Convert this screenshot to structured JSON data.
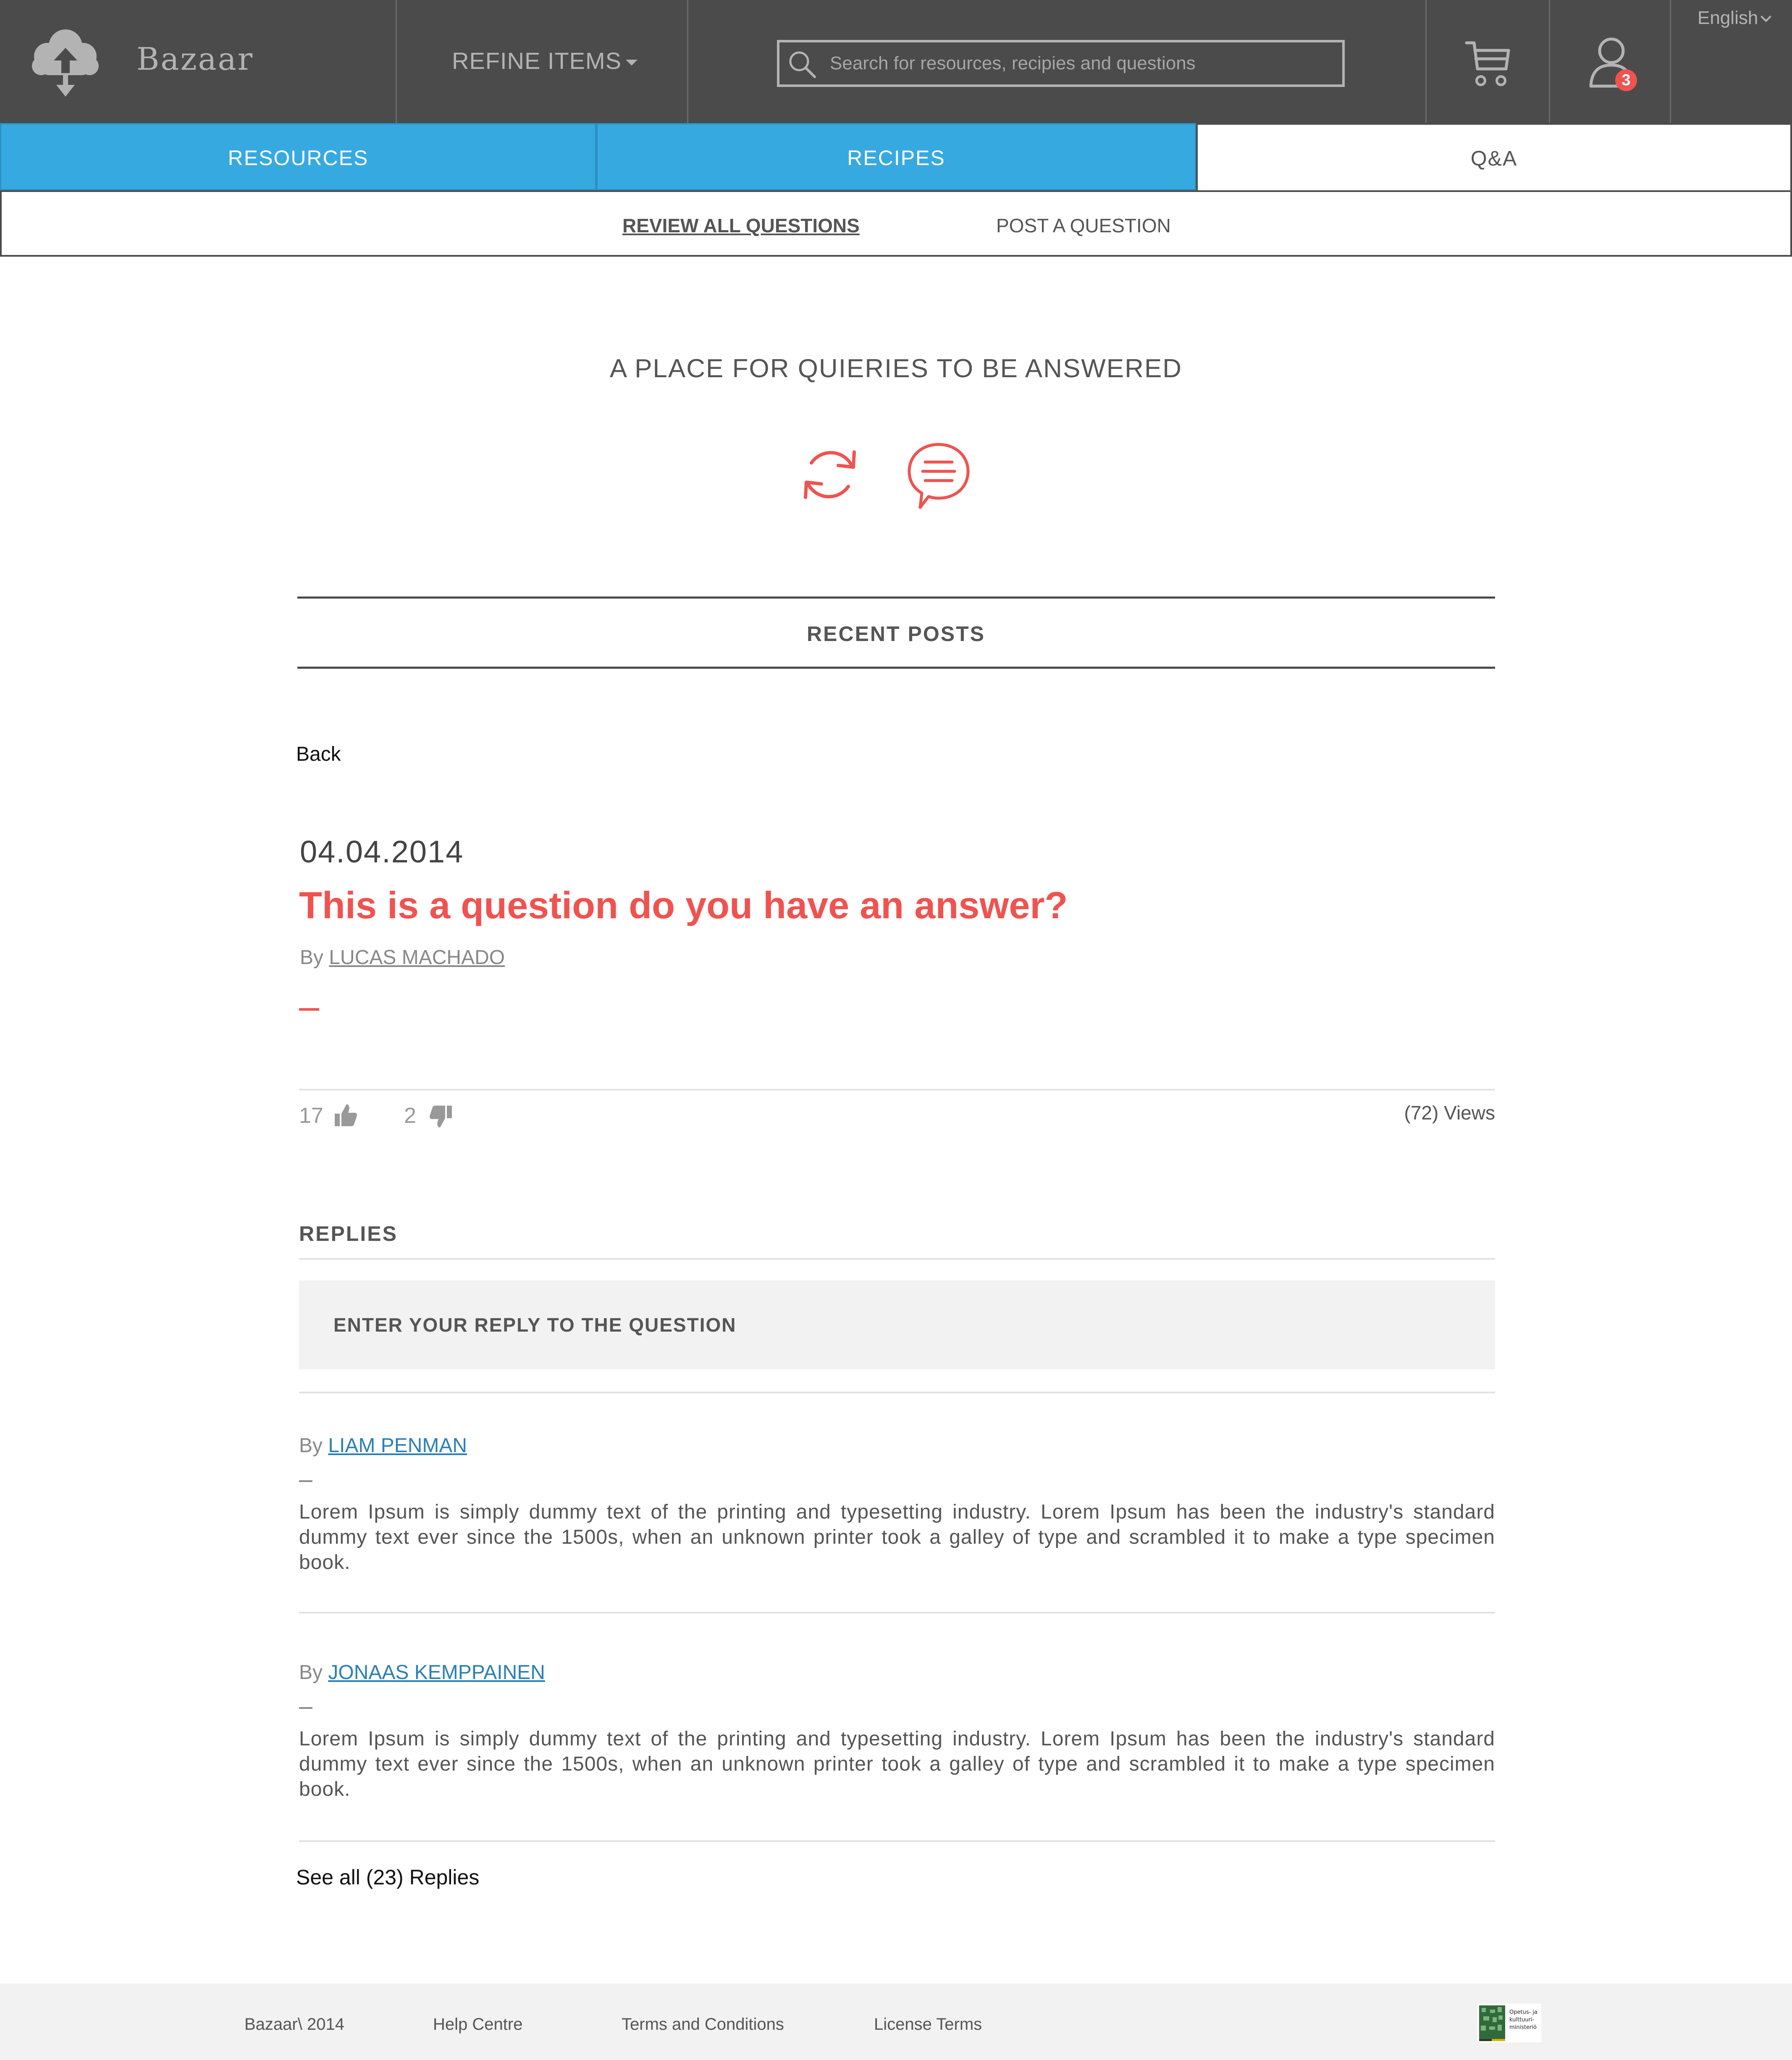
{
  "header": {
    "brand": "Bazaar",
    "refine_label": "REFINE ITEMS",
    "search_placeholder": "Search for resources, recipies and questions",
    "notification_count": "3",
    "language": "English"
  },
  "tabs": [
    {
      "label": "RESOURCES"
    },
    {
      "label": "RECIPES"
    },
    {
      "label": "Q&A"
    }
  ],
  "subnav": {
    "review_label": "REVIEW ALL QUESTIONS",
    "post_label": "POST A QUESTION"
  },
  "hero": {
    "title": "A PLACE FOR QUIERIES TO BE ANSWERED"
  },
  "recent_posts": {
    "title": "RECENT POSTS",
    "back_label": "Back"
  },
  "post": {
    "date": "04.04.2014",
    "title": "This is a question do you have an answer?",
    "by_label": "By",
    "author": "LUCAS MACHADO",
    "likes": "17",
    "dislikes": "2",
    "views": "(72) Views"
  },
  "replies": {
    "title": "REPLIES",
    "input_placeholder": "ENTER YOUR REPLY TO THE QUESTION",
    "items": [
      {
        "by_label": "By",
        "author": "LIAM PENMAN",
        "text": "Lorem Ipsum is simply dummy text of the printing and typesetting industry. Lorem Ipsum has been the industry's standard dummy text ever since the 1500s, when an unknown printer took a galley of type and scrambled it to make a type specimen book."
      },
      {
        "by_label": "By",
        "author": "JONAAS KEMPPAINEN",
        "text": "Lorem Ipsum is simply dummy text of the printing and typesetting industry. Lorem Ipsum has been the industry's standard dummy text ever since the 1500s, when an unknown printer took a galley of type and scrambled it to make a type specimen book."
      }
    ],
    "see_all_label": "See all (23) Replies"
  },
  "footer": {
    "copyright": "Bazaar\\ 2014",
    "help": "Help Centre",
    "terms": "Terms and Conditions",
    "license": "License Terms",
    "logo_text": [
      "Opetus- ja",
      "kulttuuri-",
      "ministeriö"
    ]
  },
  "colors": {
    "header_bg": "#4b4b4b",
    "tab_active_blue": "#36a9e1",
    "accent_red": "#ef5350",
    "link_blue": "#2a7fb6",
    "footer_bg": "#f2f2f2"
  },
  "icons": [
    "cloud-upload-logo-icon",
    "search-icon",
    "cart-icon",
    "user-icon",
    "refresh-icon",
    "chat-icon",
    "thumbs-up-icon",
    "thumbs-down-icon",
    "ministry-logo"
  ]
}
